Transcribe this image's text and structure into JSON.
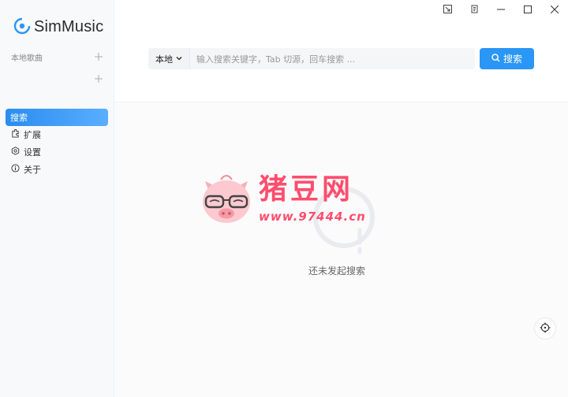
{
  "app": {
    "name": "SimMusic",
    "accent_color": "#2a96f5"
  },
  "window_controls": [
    {
      "name": "mini-mode-icon"
    },
    {
      "name": "lyrics-icon"
    },
    {
      "name": "minimize-icon"
    },
    {
      "name": "maximize-icon"
    },
    {
      "name": "close-icon"
    }
  ],
  "sidebar": {
    "sections": [
      {
        "label": "本地歌曲"
      },
      {
        "label": ""
      }
    ],
    "active_item": {
      "label": "搜索"
    },
    "items": [
      {
        "label": "扩展",
        "icon": "extension-icon"
      },
      {
        "label": "设置",
        "icon": "settings-icon"
      },
      {
        "label": "关于",
        "icon": "info-icon"
      }
    ]
  },
  "search": {
    "source": "本地",
    "placeholder": "输入搜索关键字，Tab 切源，回车搜索 ...",
    "button_label": "搜索"
  },
  "empty_state": {
    "text": "还未发起搜索"
  },
  "watermark": {
    "title": "猪豆网",
    "url": "www.97444.cn"
  }
}
